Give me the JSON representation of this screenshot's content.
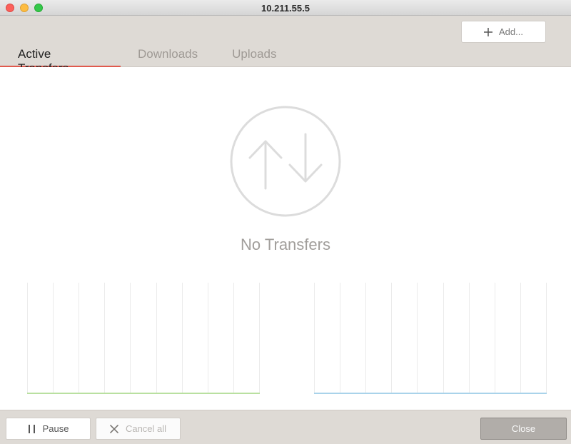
{
  "window": {
    "title": "10.211.55.5"
  },
  "toolbar": {
    "add_label": "Add...",
    "add_icon": "plus-icon"
  },
  "tabs": [
    {
      "label": "Active Transfers",
      "active": true
    },
    {
      "label": "Downloads",
      "active": false
    },
    {
      "label": "Uploads",
      "active": false
    }
  ],
  "main": {
    "empty_icon": "transfer-arrows-icon",
    "empty_text": "No Transfers"
  },
  "footer": {
    "pause_label": "Pause",
    "pause_icon": "pause-icon",
    "cancel_label": "Cancel all",
    "cancel_icon": "x-icon",
    "close_label": "Close"
  },
  "colors": {
    "accent": "#e05a4e",
    "download_graph": "#b9e0a0",
    "upload_graph": "#a9d3ea"
  }
}
